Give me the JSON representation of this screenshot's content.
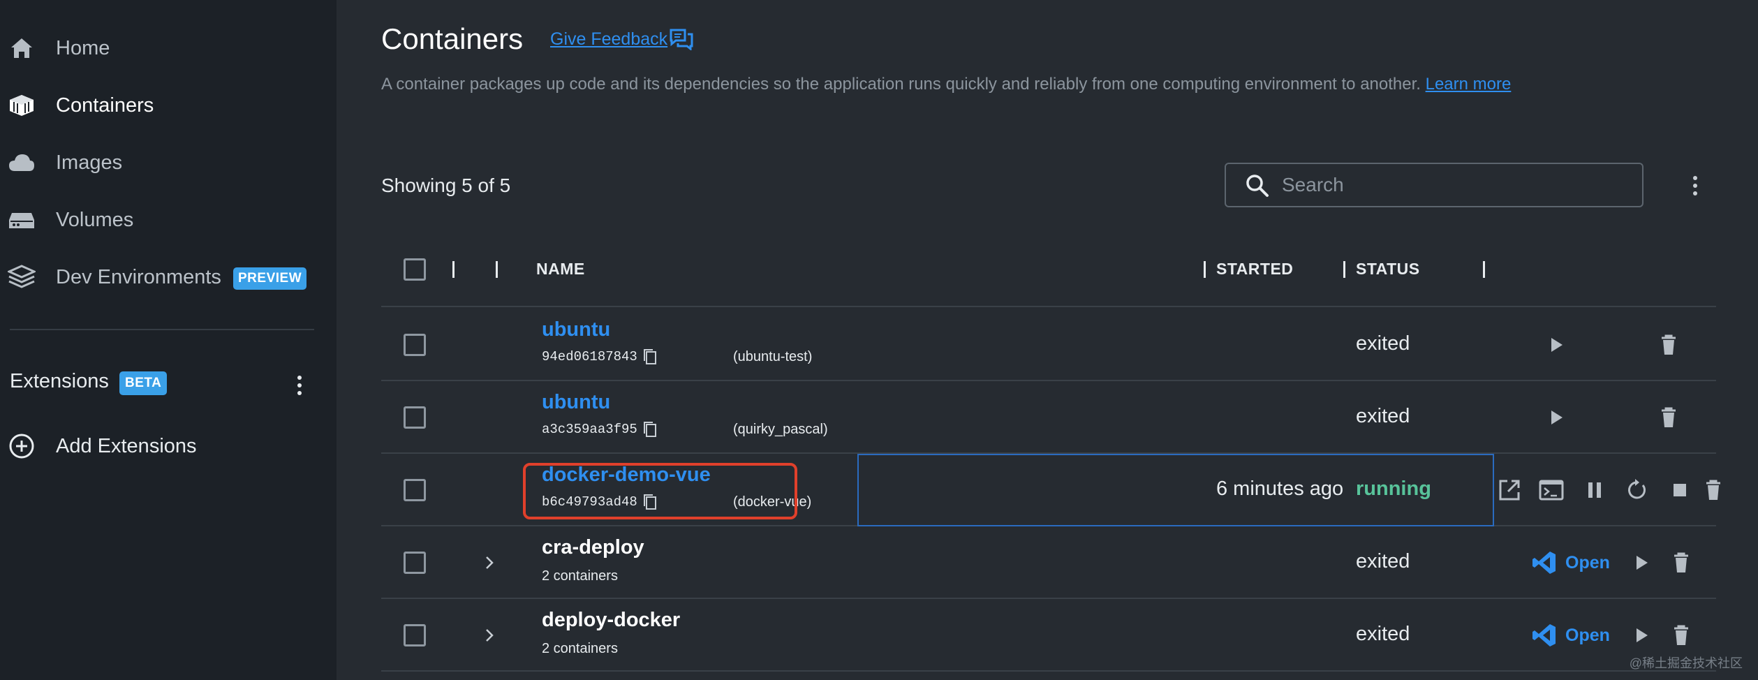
{
  "sidebar": {
    "nav": [
      {
        "label": "Home",
        "icon": "home-icon"
      },
      {
        "label": "Containers",
        "icon": "container-icon"
      },
      {
        "label": "Images",
        "icon": "cloud-icon"
      },
      {
        "label": "Volumes",
        "icon": "volume-icon"
      },
      {
        "label": "Dev Environments",
        "icon": "dev-env-icon",
        "badge": "PREVIEW"
      }
    ],
    "extensions_label": "Extensions",
    "extensions_badge": "BETA",
    "add_extensions": "Add Extensions"
  },
  "header": {
    "title": "Containers",
    "feedback": "Give Feedback",
    "subtitle": "A container packages up code and its dependencies so the application runs quickly and reliably from one computing environment to another.",
    "learn_more": "Learn more"
  },
  "toolbar": {
    "showing": "Showing 5 of 5",
    "search_placeholder": "Search"
  },
  "table": {
    "columns": {
      "name": "NAME",
      "started": "STARTED",
      "status": "STATUS"
    },
    "rows": [
      {
        "name": "ubuntu",
        "id": "94ed06187843",
        "alias": "(ubuntu-test)",
        "started": "",
        "status": "exited"
      },
      {
        "name": "ubuntu",
        "id": "a3c359aa3f95",
        "alias": "(quirky_pascal)",
        "started": "",
        "status": "exited"
      },
      {
        "name": "docker-demo-vue",
        "id": "b6c49793ad48",
        "alias": "(docker-vue)",
        "started": "6 minutes ago",
        "status": "running"
      },
      {
        "name": "cra-deploy",
        "sub": "2 containers",
        "started": "",
        "status": "exited",
        "open": "Open"
      },
      {
        "name": "deploy-docker",
        "sub": "2 containers",
        "started": "",
        "status": "exited",
        "open": "Open"
      }
    ]
  },
  "colors": {
    "accent": "#2f8ff0",
    "running": "#58c39a",
    "highlight": "#e0402b",
    "badge": "#3aa0e8"
  },
  "watermark": "@稀土掘金技术社区"
}
